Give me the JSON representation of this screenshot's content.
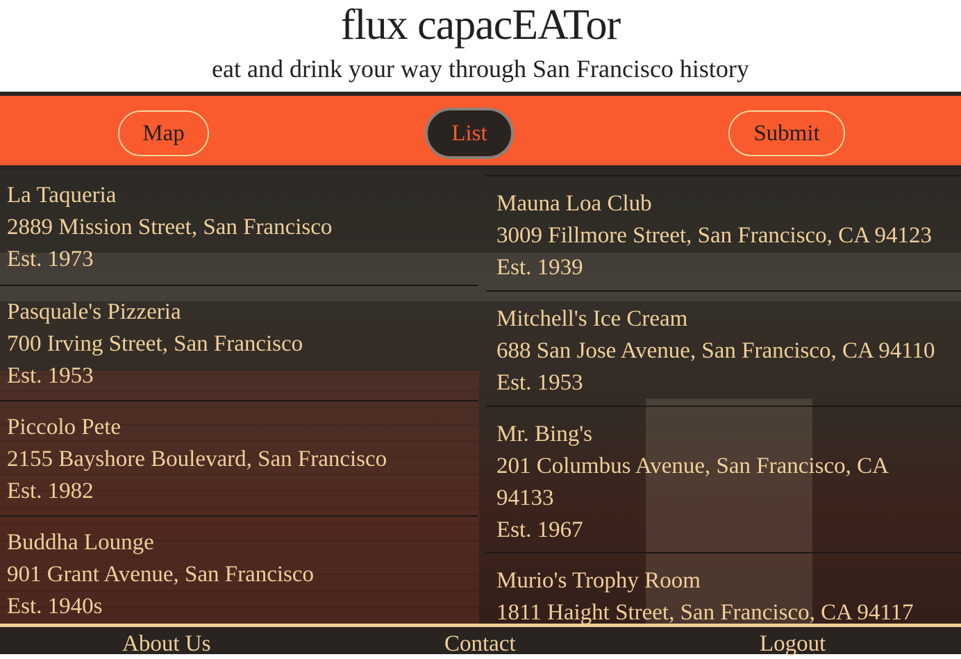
{
  "header": {
    "title": "flux capacEATor",
    "tagline": "eat and drink your way through San Francisco history"
  },
  "nav": {
    "map": "Map",
    "list": "List",
    "submit": "Submit",
    "active": "List"
  },
  "colors": {
    "nav_background": "#f95b2e",
    "dark": "#2a2421",
    "text_light": "#f0cf9a"
  },
  "restaurants_left": [
    {
      "name": "La Taqueria",
      "address": "2889 Mission Street, San Francisco",
      "established": "Est. 1973"
    },
    {
      "name": "Pasquale's Pizzeria",
      "address": "700 Irving Street, San Francisco",
      "established": "Est. 1953"
    },
    {
      "name": "Piccolo Pete",
      "address": "2155 Bayshore Boulevard, San Francisco",
      "established": "Est. 1982"
    },
    {
      "name": "Buddha Lounge",
      "address": "901 Grant Avenue, San Francisco",
      "established": "Est. 1940s"
    }
  ],
  "restaurants_right": [
    {
      "name": "Mauna Loa Club",
      "address": "3009 Fillmore Street, San Francisco, CA 94123",
      "established": "Est. 1939"
    },
    {
      "name": "Mitchell's Ice Cream",
      "address": "688 San Jose Avenue, San Francisco, CA 94110",
      "established": "Est. 1953"
    },
    {
      "name": "Mr. Bing's",
      "address": "201 Columbus Avenue, San Francisco, CA 94133",
      "established": "Est. 1967"
    },
    {
      "name": "Murio's Trophy Room",
      "address": "1811 Haight Street, San Francisco, CA 94117",
      "established": ""
    }
  ],
  "footer": {
    "about": "About Us",
    "contact": "Contact",
    "logout": "Logout"
  }
}
